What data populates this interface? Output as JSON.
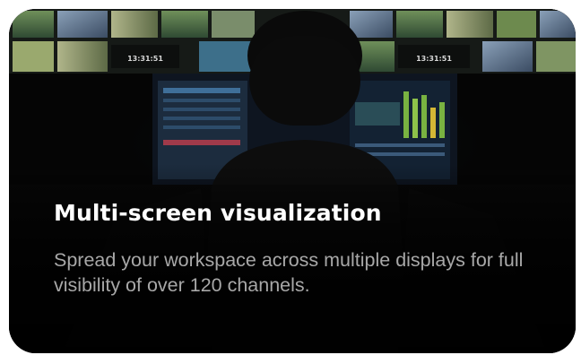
{
  "card": {
    "title": "Multi-screen visualization",
    "description": "Spread your workspace across multiple displays for full visibility of over 120 channels.",
    "image": {
      "subject": "operator-at-mixing-console",
      "monitor_clock_left": "13:31:51",
      "monitor_clock_right": "13:31:51"
    }
  },
  "colors": {
    "card_background": "#050505",
    "title": "#ffffff",
    "description": "#a8a8a8",
    "page_background": "#ffffff"
  }
}
